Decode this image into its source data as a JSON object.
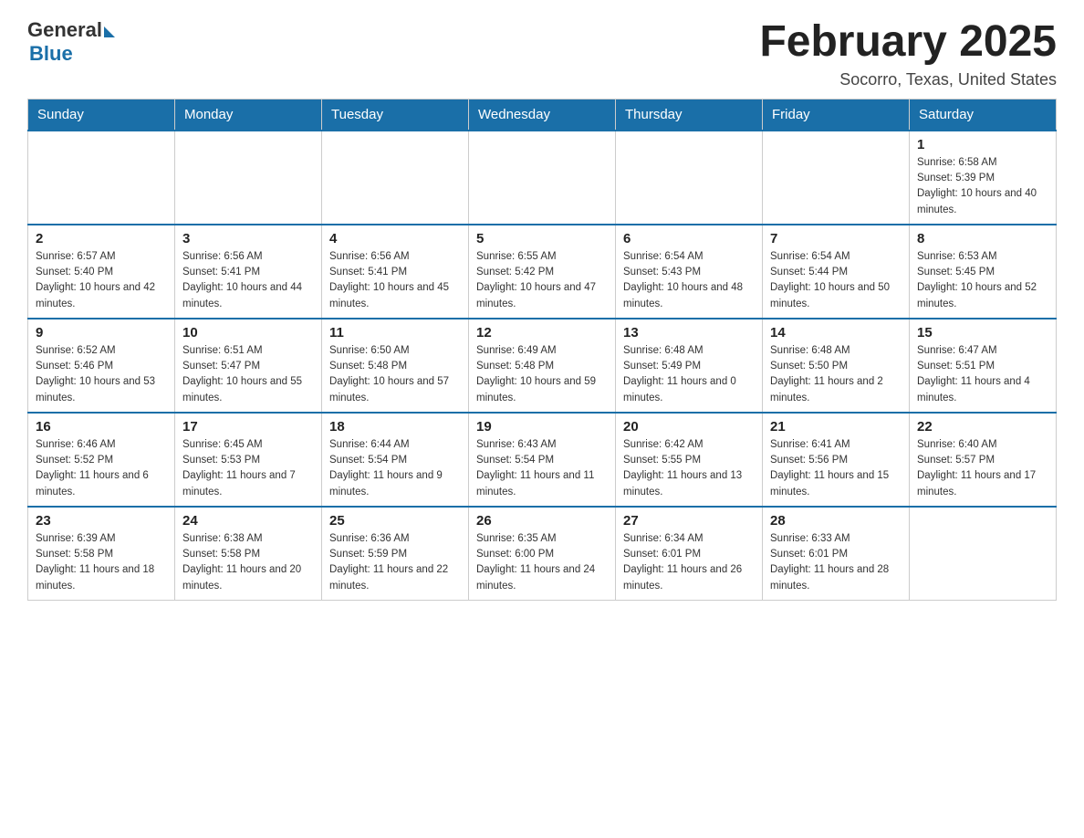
{
  "header": {
    "logo_general": "General",
    "logo_blue": "Blue",
    "month_title": "February 2025",
    "location": "Socorro, Texas, United States"
  },
  "days_of_week": [
    "Sunday",
    "Monday",
    "Tuesday",
    "Wednesday",
    "Thursday",
    "Friday",
    "Saturday"
  ],
  "weeks": [
    {
      "days": [
        {
          "num": "",
          "info": ""
        },
        {
          "num": "",
          "info": ""
        },
        {
          "num": "",
          "info": ""
        },
        {
          "num": "",
          "info": ""
        },
        {
          "num": "",
          "info": ""
        },
        {
          "num": "",
          "info": ""
        },
        {
          "num": "1",
          "info": "Sunrise: 6:58 AM\nSunset: 5:39 PM\nDaylight: 10 hours and 40 minutes."
        }
      ]
    },
    {
      "days": [
        {
          "num": "2",
          "info": "Sunrise: 6:57 AM\nSunset: 5:40 PM\nDaylight: 10 hours and 42 minutes."
        },
        {
          "num": "3",
          "info": "Sunrise: 6:56 AM\nSunset: 5:41 PM\nDaylight: 10 hours and 44 minutes."
        },
        {
          "num": "4",
          "info": "Sunrise: 6:56 AM\nSunset: 5:41 PM\nDaylight: 10 hours and 45 minutes."
        },
        {
          "num": "5",
          "info": "Sunrise: 6:55 AM\nSunset: 5:42 PM\nDaylight: 10 hours and 47 minutes."
        },
        {
          "num": "6",
          "info": "Sunrise: 6:54 AM\nSunset: 5:43 PM\nDaylight: 10 hours and 48 minutes."
        },
        {
          "num": "7",
          "info": "Sunrise: 6:54 AM\nSunset: 5:44 PM\nDaylight: 10 hours and 50 minutes."
        },
        {
          "num": "8",
          "info": "Sunrise: 6:53 AM\nSunset: 5:45 PM\nDaylight: 10 hours and 52 minutes."
        }
      ]
    },
    {
      "days": [
        {
          "num": "9",
          "info": "Sunrise: 6:52 AM\nSunset: 5:46 PM\nDaylight: 10 hours and 53 minutes."
        },
        {
          "num": "10",
          "info": "Sunrise: 6:51 AM\nSunset: 5:47 PM\nDaylight: 10 hours and 55 minutes."
        },
        {
          "num": "11",
          "info": "Sunrise: 6:50 AM\nSunset: 5:48 PM\nDaylight: 10 hours and 57 minutes."
        },
        {
          "num": "12",
          "info": "Sunrise: 6:49 AM\nSunset: 5:48 PM\nDaylight: 10 hours and 59 minutes."
        },
        {
          "num": "13",
          "info": "Sunrise: 6:48 AM\nSunset: 5:49 PM\nDaylight: 11 hours and 0 minutes."
        },
        {
          "num": "14",
          "info": "Sunrise: 6:48 AM\nSunset: 5:50 PM\nDaylight: 11 hours and 2 minutes."
        },
        {
          "num": "15",
          "info": "Sunrise: 6:47 AM\nSunset: 5:51 PM\nDaylight: 11 hours and 4 minutes."
        }
      ]
    },
    {
      "days": [
        {
          "num": "16",
          "info": "Sunrise: 6:46 AM\nSunset: 5:52 PM\nDaylight: 11 hours and 6 minutes."
        },
        {
          "num": "17",
          "info": "Sunrise: 6:45 AM\nSunset: 5:53 PM\nDaylight: 11 hours and 7 minutes."
        },
        {
          "num": "18",
          "info": "Sunrise: 6:44 AM\nSunset: 5:54 PM\nDaylight: 11 hours and 9 minutes."
        },
        {
          "num": "19",
          "info": "Sunrise: 6:43 AM\nSunset: 5:54 PM\nDaylight: 11 hours and 11 minutes."
        },
        {
          "num": "20",
          "info": "Sunrise: 6:42 AM\nSunset: 5:55 PM\nDaylight: 11 hours and 13 minutes."
        },
        {
          "num": "21",
          "info": "Sunrise: 6:41 AM\nSunset: 5:56 PM\nDaylight: 11 hours and 15 minutes."
        },
        {
          "num": "22",
          "info": "Sunrise: 6:40 AM\nSunset: 5:57 PM\nDaylight: 11 hours and 17 minutes."
        }
      ]
    },
    {
      "days": [
        {
          "num": "23",
          "info": "Sunrise: 6:39 AM\nSunset: 5:58 PM\nDaylight: 11 hours and 18 minutes."
        },
        {
          "num": "24",
          "info": "Sunrise: 6:38 AM\nSunset: 5:58 PM\nDaylight: 11 hours and 20 minutes."
        },
        {
          "num": "25",
          "info": "Sunrise: 6:36 AM\nSunset: 5:59 PM\nDaylight: 11 hours and 22 minutes."
        },
        {
          "num": "26",
          "info": "Sunrise: 6:35 AM\nSunset: 6:00 PM\nDaylight: 11 hours and 24 minutes."
        },
        {
          "num": "27",
          "info": "Sunrise: 6:34 AM\nSunset: 6:01 PM\nDaylight: 11 hours and 26 minutes."
        },
        {
          "num": "28",
          "info": "Sunrise: 6:33 AM\nSunset: 6:01 PM\nDaylight: 11 hours and 28 minutes."
        },
        {
          "num": "",
          "info": ""
        }
      ]
    }
  ]
}
